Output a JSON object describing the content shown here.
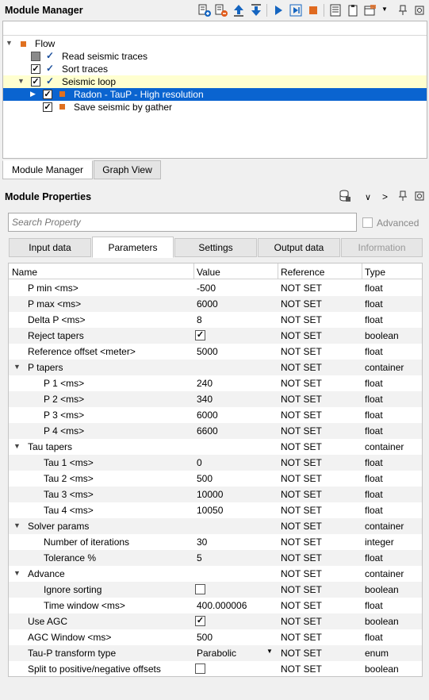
{
  "module_manager": {
    "title": "Module Manager",
    "toolbar_icons": [
      "add-module-icon",
      "remove-module-icon",
      "move-up-icon",
      "move-down-icon",
      "run-icon",
      "run-step-icon",
      "stop-icon",
      "log-icon",
      "clipboard-icon",
      "window-menu-icon",
      "pin-icon",
      "float-window-icon"
    ]
  },
  "flow_tree": {
    "root": "Flow",
    "items": [
      {
        "label": "Read seismic traces"
      },
      {
        "label": "Sort traces"
      },
      {
        "label": "Seismic loop"
      },
      {
        "label": "Radon - TauP - High resolution"
      },
      {
        "label": "Save seismic by gather"
      }
    ]
  },
  "bottom_tabs": [
    "Module Manager",
    "Graph View"
  ],
  "module_properties": {
    "title": "Module Properties",
    "search_placeholder": "Search Property",
    "advanced_label": "Advanced",
    "tabs": [
      "Input data",
      "Parameters",
      "Settings",
      "Output data",
      "Information"
    ],
    "active_tab": "Parameters"
  },
  "grid": {
    "columns": [
      "Name",
      "Value",
      "Reference",
      "Type"
    ],
    "rows": [
      {
        "name": "P min <ms>",
        "value": "-500",
        "reference": "NOT SET",
        "type": "float"
      },
      {
        "name": "P max <ms>",
        "value": "6000",
        "reference": "NOT SET",
        "type": "float"
      },
      {
        "name": "Delta P <ms>",
        "value": "8",
        "reference": "NOT SET",
        "type": "float"
      },
      {
        "name": "Reject tapers",
        "value": "",
        "checked": true,
        "reference": "NOT SET",
        "type": "boolean"
      },
      {
        "name": "Reference offset <meter>",
        "value": "5000",
        "reference": "NOT SET",
        "type": "float"
      },
      {
        "name": "P tapers",
        "value": "",
        "reference": "NOT SET",
        "type": "container"
      },
      {
        "name": "P 1 <ms>",
        "value": "240",
        "reference": "NOT SET",
        "type": "float"
      },
      {
        "name": "P 2 <ms>",
        "value": "340",
        "reference": "NOT SET",
        "type": "float"
      },
      {
        "name": "P 3 <ms>",
        "value": "6000",
        "reference": "NOT SET",
        "type": "float"
      },
      {
        "name": "P 4 <ms>",
        "value": "6600",
        "reference": "NOT SET",
        "type": "float"
      },
      {
        "name": "Tau tapers",
        "value": "",
        "reference": "NOT SET",
        "type": "container"
      },
      {
        "name": "Tau 1 <ms>",
        "value": "0",
        "reference": "NOT SET",
        "type": "float"
      },
      {
        "name": "Tau 2 <ms>",
        "value": "500",
        "reference": "NOT SET",
        "type": "float"
      },
      {
        "name": "Tau 3 <ms>",
        "value": "10000",
        "reference": "NOT SET",
        "type": "float"
      },
      {
        "name": "Tau 4 <ms>",
        "value": "10050",
        "reference": "NOT SET",
        "type": "float"
      },
      {
        "name": "Solver params",
        "value": "",
        "reference": "NOT SET",
        "type": "container"
      },
      {
        "name": "Number of iterations",
        "value": "30",
        "reference": "NOT SET",
        "type": "integer"
      },
      {
        "name": "Tolerance %",
        "value": "5",
        "reference": "NOT SET",
        "type": "float"
      },
      {
        "name": "Advance",
        "value": "",
        "reference": "NOT SET",
        "type": "container"
      },
      {
        "name": "Ignore sorting",
        "value": "",
        "checked": false,
        "reference": "NOT SET",
        "type": "boolean"
      },
      {
        "name": "Time window <ms>",
        "value": "400.000006",
        "reference": "NOT SET",
        "type": "float"
      },
      {
        "name": "Use AGC",
        "value": "",
        "checked": true,
        "reference": "NOT SET",
        "type": "boolean"
      },
      {
        "name": "AGC Window <ms>",
        "value": "500",
        "reference": "NOT SET",
        "type": "float"
      },
      {
        "name": "Tau-P transform type",
        "value": "Parabolic",
        "reference": "NOT SET",
        "type": "enum"
      },
      {
        "name": "Split to positive/negative offsets",
        "value": "",
        "checked": false,
        "reference": "NOT SET",
        "type": "boolean"
      }
    ]
  }
}
